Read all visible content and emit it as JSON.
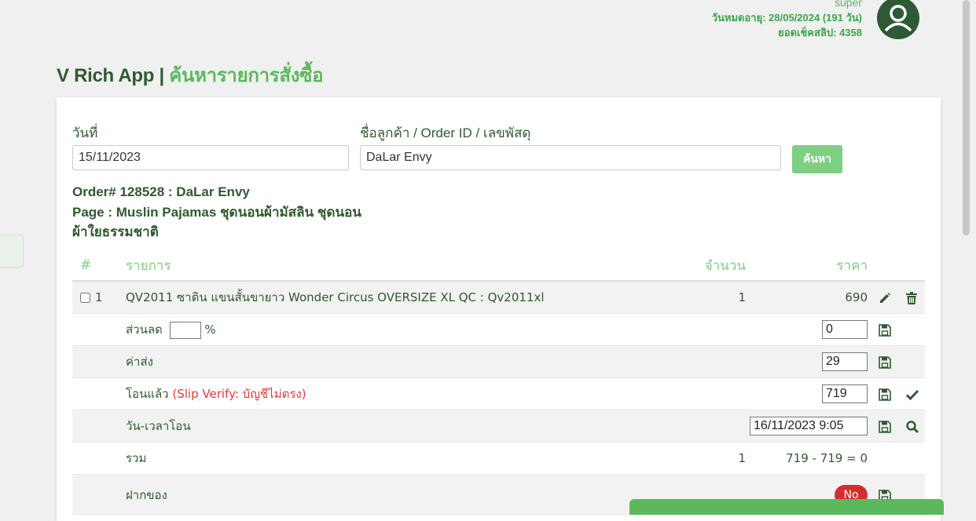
{
  "user": {
    "name": "super",
    "expiry": "วันหมดอายุ: 28/05/2024 (191 วัน)",
    "slip_balance": "ยอดเช็คสลิป: 4358"
  },
  "title": {
    "app": "V Rich App | ",
    "page": "ค้นหารายการสั่งซื้อ"
  },
  "search": {
    "date_label": "วันที่",
    "date_value": "15/11/2023",
    "query_label": "ชื่อลูกค้า / Order ID / เลขพัสดุ",
    "query_value": "DaLar Envy",
    "button": "ค้นหา"
  },
  "order": {
    "line1": "Order# 128528 : DaLar Envy",
    "line2": "Page : Muslin Pajamas ชุดนอนผ้ามัสลิน ชุดนอน",
    "line3": "ผ้าใยธรรมชาติ"
  },
  "table": {
    "headers": {
      "idx": "#",
      "item": "รายการ",
      "qty": "จำนวน",
      "price": "ราคา"
    },
    "item_row": {
      "index": "1",
      "name": "QV2011 ซาติน แขนสั้นขายาว Wonder Circus OVERSIZE XL QC : Qv2011xl",
      "qty": "1",
      "price": "690"
    },
    "discount": {
      "label": "ส่วนลด",
      "percent_sign": "%",
      "value": "0"
    },
    "shipping": {
      "label": "ค่าส่ง",
      "value": "29"
    },
    "transferred": {
      "label": "โอนแล้ว",
      "note": "(Slip Verify: บัญชีไม่ตรง)",
      "value": "719"
    },
    "transfer_time": {
      "label": "วัน-เวลาโอน",
      "value": "16/11/2023 9:05"
    },
    "total": {
      "label": "รวม",
      "qty": "1",
      "calc": "719 - 719 = 0"
    },
    "deposit": {
      "label": "ฝากของ",
      "toggle": "No"
    }
  },
  "colors": {
    "accent": "#5cb85c",
    "text": "#2f5a2f",
    "warning": "#e53935",
    "toggle_off": "#d32f2f"
  }
}
